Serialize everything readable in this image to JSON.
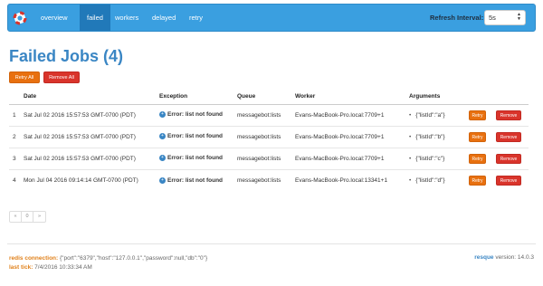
{
  "nav": {
    "items": [
      {
        "label": "overview",
        "active": false
      },
      {
        "label": "failed",
        "active": true
      },
      {
        "label": "workers",
        "active": false
      },
      {
        "label": "delayed",
        "active": false
      },
      {
        "label": "retry",
        "active": false
      }
    ],
    "refresh_label": "Refresh Interval:",
    "refresh_value": "5s"
  },
  "page_title": "Failed Jobs (4)",
  "actions": {
    "retry_all": "Retry All",
    "remove_all": "Remove All"
  },
  "table": {
    "headers": [
      "",
      "Date",
      "Exception",
      "Queue",
      "Worker",
      "Arguments",
      "",
      ""
    ],
    "rows": [
      {
        "num": "1",
        "date": "Sat Jul 02 2016 15:57:53 GMT-0700 (PDT)",
        "exception": "Error: list not found",
        "queue": "messagebot:lists",
        "worker": "Evans-MacBook-Pro.local:7709+1",
        "args": "{\"listId\":\"a\"}",
        "retry": "Retry",
        "remove": "Remove"
      },
      {
        "num": "2",
        "date": "Sat Jul 02 2016 15:57:53 GMT-0700 (PDT)",
        "exception": "Error: list not found",
        "queue": "messagebot:lists",
        "worker": "Evans-MacBook-Pro.local:7709+1",
        "args": "{\"listId\":\"b\"}",
        "retry": "Retry",
        "remove": "Remove"
      },
      {
        "num": "3",
        "date": "Sat Jul 02 2016 15:57:53 GMT-0700 (PDT)",
        "exception": "Error: list not found",
        "queue": "messagebot:lists",
        "worker": "Evans-MacBook-Pro.local:7709+1",
        "args": "{\"listId\":\"c\"}",
        "retry": "Retry",
        "remove": "Remove"
      },
      {
        "num": "4",
        "date": "Mon Jul 04 2016 09:14:14 GMT-0700 (PDT)",
        "exception": "Error: list not found",
        "queue": "messagebot:lists",
        "worker": "Evans-MacBook-Pro.local:13341+1",
        "args": "{\"listId\":\"d\"}",
        "retry": "Retry",
        "remove": "Remove"
      }
    ]
  },
  "pager": {
    "prev": "«",
    "page": "0",
    "next": "»"
  },
  "footer": {
    "redis_label": "redis connection:",
    "redis_value": " {\"port\":\"6379\",\"host\":\"127.0.0.1\",\"password\":null,\"db\":\"0\"}",
    "tick_label": "last tick:",
    "tick_value": " 7/4/2016 10:33:34 AM",
    "version_label": "resque",
    "version_value": " version: 14.0.3"
  },
  "colors": {
    "navbar": "#3a9fe0",
    "nav_active": "#2179b9",
    "title": "#3a86c4",
    "retry": "#e8700f",
    "remove": "#d9342b",
    "queue": "#2c8a2c"
  },
  "icons": {
    "brand": "lifebuoy-icon",
    "exception": "plus-circle-icon",
    "refresh_select": "select-arrows-icon"
  }
}
